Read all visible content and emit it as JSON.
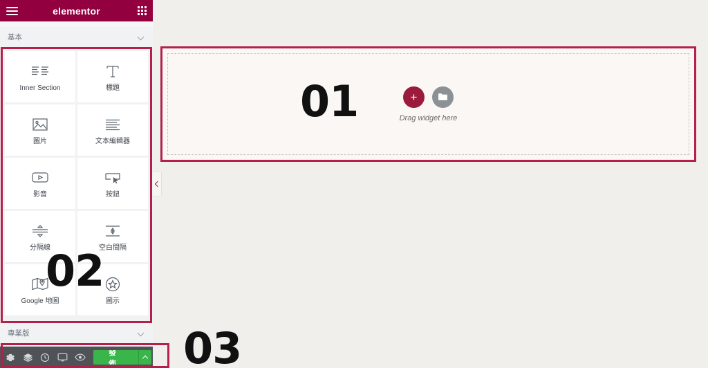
{
  "panel": {
    "header": {
      "brand": "elementor",
      "menu_icon": "hamburger-icon",
      "apps_icon": "apps-grid-icon"
    },
    "category_basic": {
      "label": "基本",
      "chevron": "chevron-down-icon"
    },
    "category_pro": {
      "label": "專業版",
      "chevron": "chevron-down-icon"
    },
    "widgets": [
      {
        "label": "Inner Section",
        "icon": "inner-section-icon"
      },
      {
        "label": "標題",
        "icon": "heading-icon"
      },
      {
        "label": "圖片",
        "icon": "image-icon"
      },
      {
        "label": "文本編輯器",
        "icon": "text-editor-icon"
      },
      {
        "label": "影音",
        "icon": "video-icon"
      },
      {
        "label": "按鈕",
        "icon": "button-icon"
      },
      {
        "label": "分隔線",
        "icon": "divider-icon"
      },
      {
        "label": "空白間隔",
        "icon": "spacer-icon"
      },
      {
        "label": "Google 地圖",
        "icon": "google-maps-icon"
      },
      {
        "label": "圖示",
        "icon": "star-icon"
      }
    ],
    "toolbar": {
      "icons": [
        {
          "name": "settings-gear-icon"
        },
        {
          "name": "navigator-layers-icon"
        },
        {
          "name": "history-clock-icon"
        },
        {
          "name": "responsive-monitor-icon"
        },
        {
          "name": "preview-eye-icon"
        }
      ],
      "publish_label": "發佈",
      "publish_caret": "chevron-up-icon",
      "publish_color": "#39b54a"
    }
  },
  "canvas": {
    "dropzone": {
      "add_label": "+",
      "add_color": "#9b1b3c",
      "folder_icon": "folder-icon",
      "folder_color": "#8c9196",
      "hint": "Drag widget here"
    },
    "collapse_handle": "chevron-left-icon"
  },
  "annotations": {
    "accent_color": "#b4204a",
    "numbers": [
      {
        "value": "01",
        "target": "canvas-section"
      },
      {
        "value": "02",
        "target": "widget-panel"
      },
      {
        "value": "03",
        "target": "bottom-toolbar"
      }
    ]
  }
}
